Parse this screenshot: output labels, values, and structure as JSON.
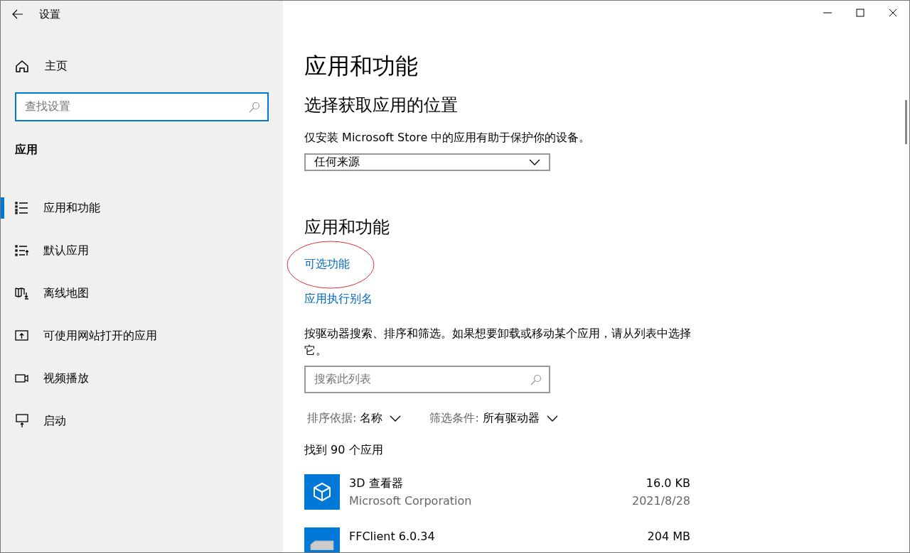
{
  "window": {
    "title": "设置"
  },
  "sidebar": {
    "home": "主页",
    "search": {
      "placeholder": "查找设置"
    },
    "section": "应用",
    "items": [
      {
        "label": "应用和功能",
        "kind": "list",
        "selected": true
      },
      {
        "label": "默认应用",
        "kind": "default",
        "selected": false
      },
      {
        "label": "离线地图",
        "kind": "map",
        "selected": false
      },
      {
        "label": "可使用网站打开的应用",
        "kind": "web",
        "selected": false
      },
      {
        "label": "视频播放",
        "kind": "video",
        "selected": false
      },
      {
        "label": "启动",
        "kind": "startup",
        "selected": false
      }
    ]
  },
  "main": {
    "title": "应用和功能",
    "source_heading": "选择获取应用的位置",
    "source_description": "仅安装 Microsoft Store 中的应用有助于保护你的设备。",
    "source_dropdown": "任何来源",
    "apps_heading": "应用和功能",
    "links": [
      {
        "label": "可选功能",
        "highlighted": true
      },
      {
        "label": "应用执行别名",
        "highlighted": false
      }
    ],
    "apps_description": "按驱动器搜索、排序和筛选。如果想要卸载或移动某个应用，请从列表中选择它。",
    "apps_search": {
      "placeholder": "搜索此列表"
    },
    "sort": {
      "label": "排序依据:",
      "value": "名称"
    },
    "filter": {
      "label": "筛选条件:",
      "value": "所有驱动器"
    },
    "count": "找到 90 个应用",
    "apps": [
      {
        "name": "3D 查看器",
        "publisher": "Microsoft Corporation",
        "size": "16.0 KB",
        "date": "2021/8/28",
        "kind": "cube"
      },
      {
        "name": "FFClient 6.0.34",
        "size": "204 MB",
        "kind": "box"
      }
    ]
  }
}
